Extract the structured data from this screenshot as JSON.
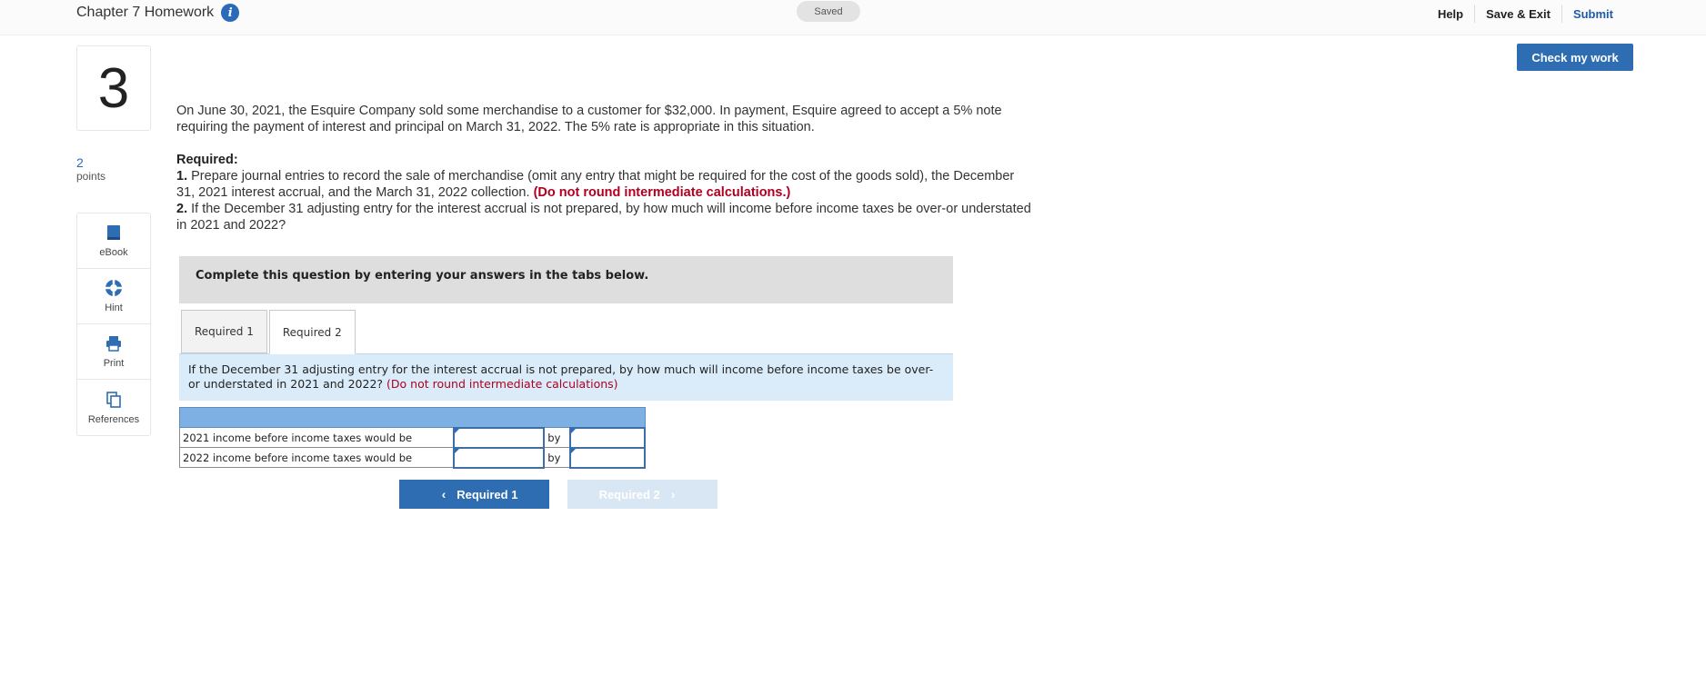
{
  "header": {
    "title": "Chapter 7 Homework",
    "info_icon": "i",
    "saved_status": "Saved",
    "links": {
      "help": "Help",
      "save_exit": "Save & Exit",
      "submit": "Submit"
    },
    "check_button": "Check my work"
  },
  "question": {
    "number": "3",
    "points_value": "2",
    "points_label": "points",
    "intro": "On June 30, 2021, the Esquire Company sold some merchandise to a customer for $32,000. In payment, Esquire agreed to accept a 5% note requiring the payment of interest and principal on March 31, 2022. The 5% rate is appropriate in this situation.",
    "required_heading": "Required:",
    "req1_num": "1.",
    "req1_text": "Prepare journal entries to record the sale of merchandise (omit any entry that might be required for the cost of the goods sold), the December 31, 2021 interest accrual, and the March 31, 2022 collection.",
    "req1_warning": "(Do not round intermediate calculations.)",
    "req2_num": "2.",
    "req2_text": "If the December 31 adjusting entry for the interest accrual is not prepared, by how much will income before income taxes be over-or understated in 2021 and 2022?"
  },
  "tools": [
    {
      "label": "eBook",
      "icon": "book-icon"
    },
    {
      "label": "Hint",
      "icon": "lifebuoy-icon"
    },
    {
      "label": "Print",
      "icon": "printer-icon"
    },
    {
      "label": "References",
      "icon": "copy-icon"
    }
  ],
  "workspace": {
    "complete_text": "Complete this question by entering your answers in the tabs below.",
    "tabs": [
      "Required 1",
      "Required 2"
    ],
    "active_tab": "Required 2",
    "instruction": "If the December 31 adjusting entry for the interest accrual is not prepared, by how much will income before income taxes be over-or understated in 2021 and 2022?",
    "instruction_hint": "(Do not round intermediate calculations)",
    "rows": [
      {
        "label": "2021 income before income taxes would be",
        "by": "by",
        "value1": "",
        "value2": ""
      },
      {
        "label": "2022 income before income taxes would be",
        "by": "by",
        "value1": "",
        "value2": ""
      }
    ],
    "prev_button": "Required 1",
    "next_button": "Required 2"
  },
  "colors": {
    "accent": "#2f6db3",
    "warning": "#b00020",
    "instruction_bg": "#daecf9",
    "table_header": "#7fb0e3"
  }
}
